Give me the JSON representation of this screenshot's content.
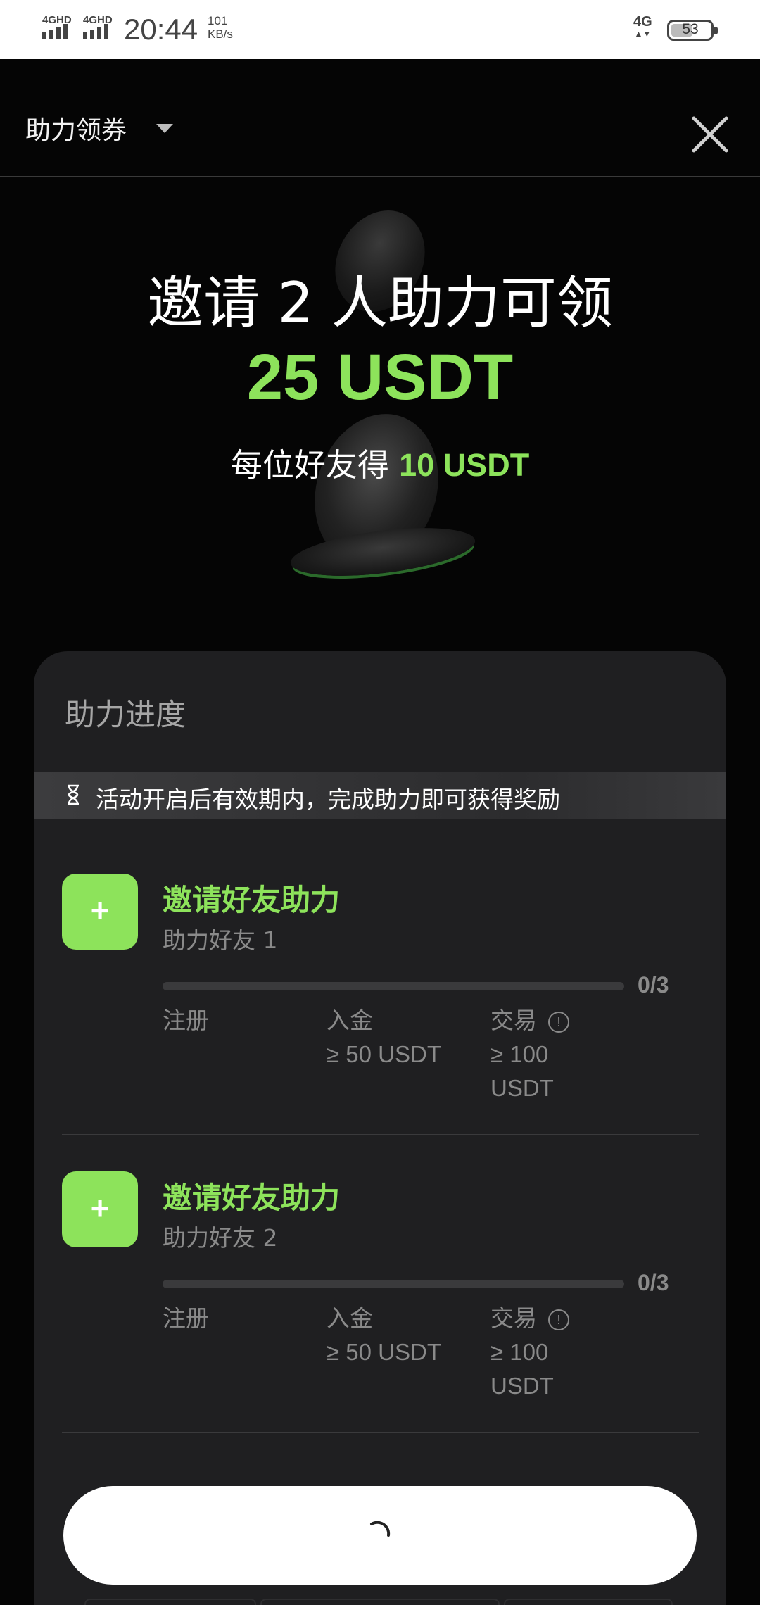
{
  "status_bar": {
    "signal1": "4GHD",
    "signal2": "4GHD",
    "time": "20:44",
    "speed_value": "101",
    "speed_unit": "KB/s",
    "network": "4G",
    "battery": "53"
  },
  "header": {
    "title": "助力领券"
  },
  "hero": {
    "line1": "邀请 2 人助力可领",
    "amount": "25 USDT",
    "line3_prefix": "每位好友得 ",
    "line3_amount": "10 USDT"
  },
  "progress": {
    "title": "助力进度",
    "notice": "活动开启后有效期内，完成助力即可获得奖励",
    "tasks": [
      {
        "title": "邀请好友助力",
        "subtitle": "助力好友 1",
        "count": "0/3",
        "progress": 0,
        "step1": "注册",
        "step2": "入金",
        "step2_value": "≥ 50 USDT",
        "step3": "交易",
        "step3_value": "≥ 100 USDT",
        "plus": "+"
      },
      {
        "title": "邀请好友助力",
        "subtitle": "助力好友 2",
        "count": "0/3",
        "progress": 0,
        "step1": "注册",
        "step2": "入金",
        "step2_value": "≥ 50 USDT",
        "step3": "交易",
        "step3_value": "≥ 100 USDT",
        "plus": "+"
      }
    ]
  },
  "icons": {
    "close": "close-icon",
    "dropdown": "caret-down-icon",
    "hourglass": "hourglass-icon",
    "info": "info-icon",
    "spinner": "loading-spinner-icon"
  },
  "colors": {
    "accent_green": "#8de35b",
    "background": "#050505",
    "card": "#1f1f21"
  }
}
